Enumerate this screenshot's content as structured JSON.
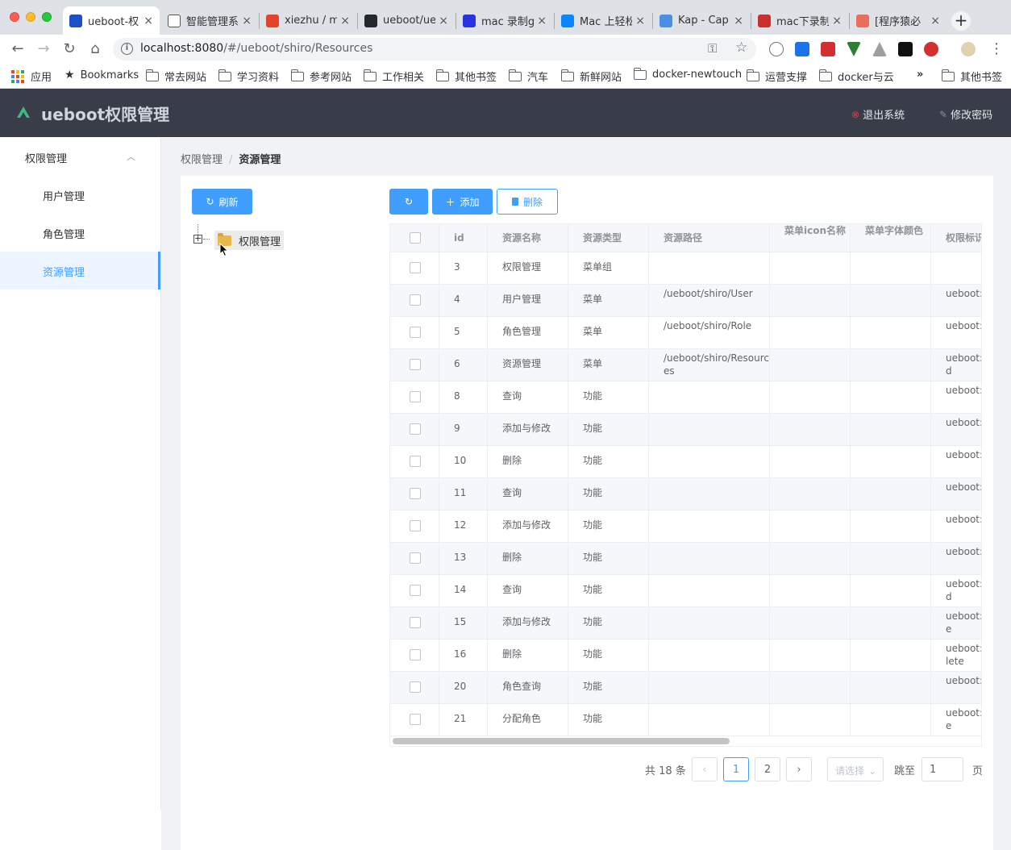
{
  "browser": {
    "tabs": [
      {
        "title": "ueboot-权",
        "icon": "ueboot-favicon",
        "color": "#1a50c8"
      },
      {
        "title": "智能管理系",
        "icon": "page-icon",
        "color": "#ffffff"
      },
      {
        "title": "xiezhu / m",
        "icon": "gitlab-icon",
        "color": "#e24329"
      },
      {
        "title": "ueboot/ue",
        "icon": "github-icon",
        "color": "#24292e"
      },
      {
        "title": "mac 录制g",
        "icon": "baidu-icon",
        "color": "#2932e1"
      },
      {
        "title": "Mac 上轻松",
        "icon": "zhihu-icon",
        "color": "#0a84ff"
      },
      {
        "title": "Kap - Cap",
        "icon": "kap-icon",
        "color": "#4a90e2"
      },
      {
        "title": "mac下录制",
        "icon": "csdn-icon",
        "color": "#c9302c"
      },
      {
        "title": "[程序猿必",
        "icon": "jianshu-icon",
        "color": "#ea6f5a"
      }
    ],
    "url_host": "localhost:8080",
    "url_path": "/#/ueboot/shiro/Resources",
    "bookmarks": [
      "应用",
      "Bookmarks",
      "常去网站",
      "学习资料",
      "参考网站",
      "工作相关",
      "其他书签",
      "汽车",
      "新鲜网站",
      "docker-newtouch",
      "运营支撑",
      "docker与云"
    ],
    "more_bookmarks": "»",
    "other_bookmarks": "其他书签"
  },
  "header": {
    "title": "ueboot权限管理",
    "logout_label": "退出系统",
    "change_password_label": "修改密码"
  },
  "sidebar": {
    "group_label": "权限管理",
    "items": [
      {
        "label": "用户管理"
      },
      {
        "label": "角色管理"
      },
      {
        "label": "资源管理"
      }
    ]
  },
  "breadcrumb": {
    "parent": "权限管理",
    "current": "资源管理"
  },
  "toolbar": {
    "refresh_label": "刷新",
    "add_label": "添加",
    "delete_label": "删除"
  },
  "tree": {
    "root_label": "权限管理"
  },
  "table": {
    "columns": [
      "id",
      "资源名称",
      "资源类型",
      "资源路径",
      "菜单icon名称",
      "菜单字体颜色",
      "权限标识"
    ],
    "rows": [
      {
        "id": "3",
        "name": "权限管理",
        "type": "菜单组",
        "path": "",
        "perm": ""
      },
      {
        "id": "4",
        "name": "用户管理",
        "type": "菜单",
        "path": "/ueboot/shiro/User",
        "perm": "ueboot:r"
      },
      {
        "id": "5",
        "name": "角色管理",
        "type": "菜单",
        "path": "/ueboot/shiro/Role",
        "perm": "ueboot:r"
      },
      {
        "id": "6",
        "name": "资源管理",
        "type": "菜单",
        "path": "/ueboot/shiro/Resources",
        "perm": "ueboot:r ead"
      },
      {
        "id": "8",
        "name": "查询",
        "type": "功能",
        "path": "",
        "perm": "ueboot:r"
      },
      {
        "id": "9",
        "name": "添加与修改",
        "type": "功能",
        "path": "",
        "perm": "ueboot:r"
      },
      {
        "id": "10",
        "name": "删除",
        "type": "功能",
        "path": "",
        "perm": "ueboot:r"
      },
      {
        "id": "11",
        "name": "查询",
        "type": "功能",
        "path": "",
        "perm": "ueboot:r"
      },
      {
        "id": "12",
        "name": "添加与修改",
        "type": "功能",
        "path": "",
        "perm": "ueboot:r"
      },
      {
        "id": "13",
        "name": "删除",
        "type": "功能",
        "path": "",
        "perm": "ueboot:r"
      },
      {
        "id": "14",
        "name": "查询",
        "type": "功能",
        "path": "",
        "perm": "ueboot:r ead"
      },
      {
        "id": "15",
        "name": "添加与修改",
        "type": "功能",
        "path": "",
        "perm": "ueboot:r ave"
      },
      {
        "id": "16",
        "name": "删除",
        "type": "功能",
        "path": "",
        "perm": "ueboot:r delete"
      },
      {
        "id": "20",
        "name": "角色查询",
        "type": "功能",
        "path": "",
        "perm": "ueboot:r"
      },
      {
        "id": "21",
        "name": "分配角色",
        "type": "功能",
        "path": "",
        "perm": "ueboot:r ave"
      }
    ]
  },
  "pagination": {
    "total_label": "共 18 条",
    "pages": [
      "1",
      "2"
    ],
    "current_page": "1",
    "page_size_placeholder": "请选择",
    "jump_label": "跳至",
    "jump_value": "1",
    "page_suffix": "页"
  },
  "colors": {
    "primary": "#409eff",
    "header_bg": "#393d49",
    "logo": "#41b883"
  }
}
